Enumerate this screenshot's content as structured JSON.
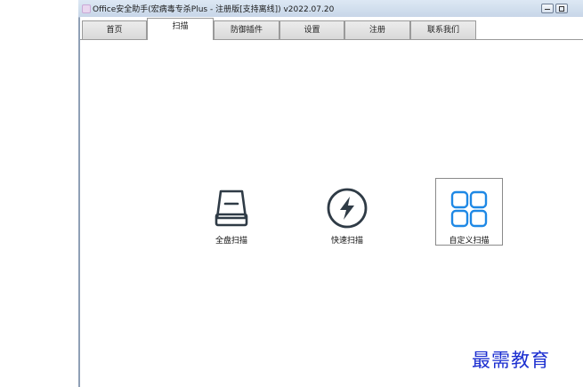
{
  "window": {
    "title": "Office安全助手(宏病毒专杀Plus - 注册版[支持离线]) v2022.07.20"
  },
  "tabs": [
    {
      "label": "首页"
    },
    {
      "label": "扫描"
    },
    {
      "label": "防御插件"
    },
    {
      "label": "设置"
    },
    {
      "label": "注册"
    },
    {
      "label": "联系我们"
    }
  ],
  "active_tab": "扫描",
  "scan_options": [
    {
      "label": "全盘扫描",
      "icon": "hard-drive-icon"
    },
    {
      "label": "快速扫描",
      "icon": "lightning-icon"
    },
    {
      "label": "自定义扫描",
      "icon": "grid-icon"
    }
  ],
  "colors": {
    "accent": "#1e88e5",
    "icon_dark": "#2f3b46",
    "watermark": "#1b2ed0"
  },
  "watermark": "最需教育"
}
